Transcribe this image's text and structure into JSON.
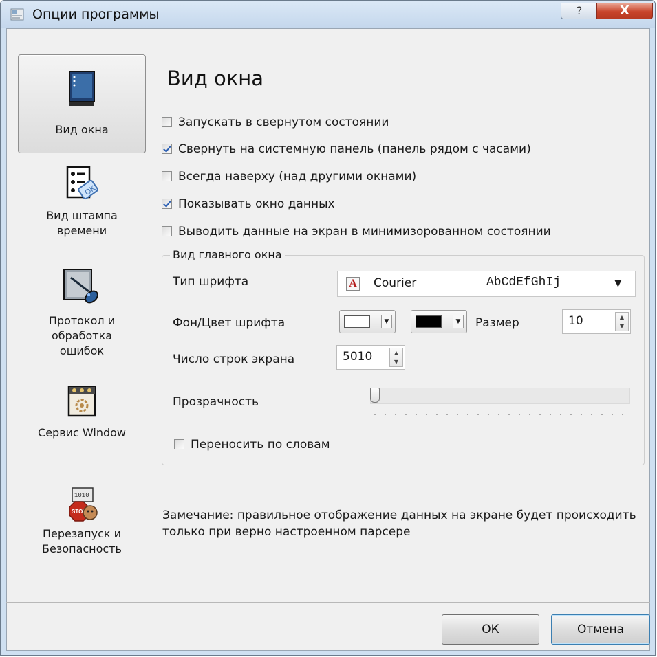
{
  "window": {
    "title": "Опции программы",
    "help_glyph": "?",
    "close_glyph": "X"
  },
  "sidebar": {
    "items": [
      {
        "label": "Вид окна",
        "icon": "window-view-icon"
      },
      {
        "label": "Вид штампа времени",
        "icon": "timestamp-stamp-icon"
      },
      {
        "label": "Протокол и обработка ошибок",
        "icon": "protocol-errors-icon"
      },
      {
        "label": "Сервис Window",
        "icon": "windows-service-icon"
      },
      {
        "label": "Перезапуск и Безопасность",
        "icon": "restart-security-icon"
      }
    ],
    "selected_index": 0
  },
  "main": {
    "heading": "Вид окна",
    "options": [
      {
        "label": "Запускать в свернутом состоянии",
        "checked": false
      },
      {
        "label": "Свернуть на системную панель (панель рядом с часами)",
        "checked": true
      },
      {
        "label": "Всегда наверху (над другими окнами)",
        "checked": false
      },
      {
        "label": "Показывать окно данных",
        "checked": true
      },
      {
        "label": "Выводить данные на экран в минимизорованном состоянии",
        "checked": false
      }
    ],
    "group": {
      "legend": "Вид главного окна",
      "font_type_label": "Тип шрифта",
      "font_name": "Courier",
      "font_sample": "AbCdEfGhIj",
      "colors_label": "Фон/Цвет шрифта",
      "background_color": "#ffffff",
      "font_color": "#000000",
      "size_label": "Размер",
      "size_value": "10",
      "lines_label": "Число строк экрана",
      "lines_value": "5010",
      "transparency_label": "Прозрачность",
      "transparency_value": 0,
      "word_wrap_label": "Переносить по словам",
      "word_wrap_checked": false
    },
    "note": "Замечание: правильное отображение данных на экране будет происходить только при верно настроенном парсере"
  },
  "footer": {
    "ok_label": "ОК",
    "cancel_label": "Отмена"
  }
}
